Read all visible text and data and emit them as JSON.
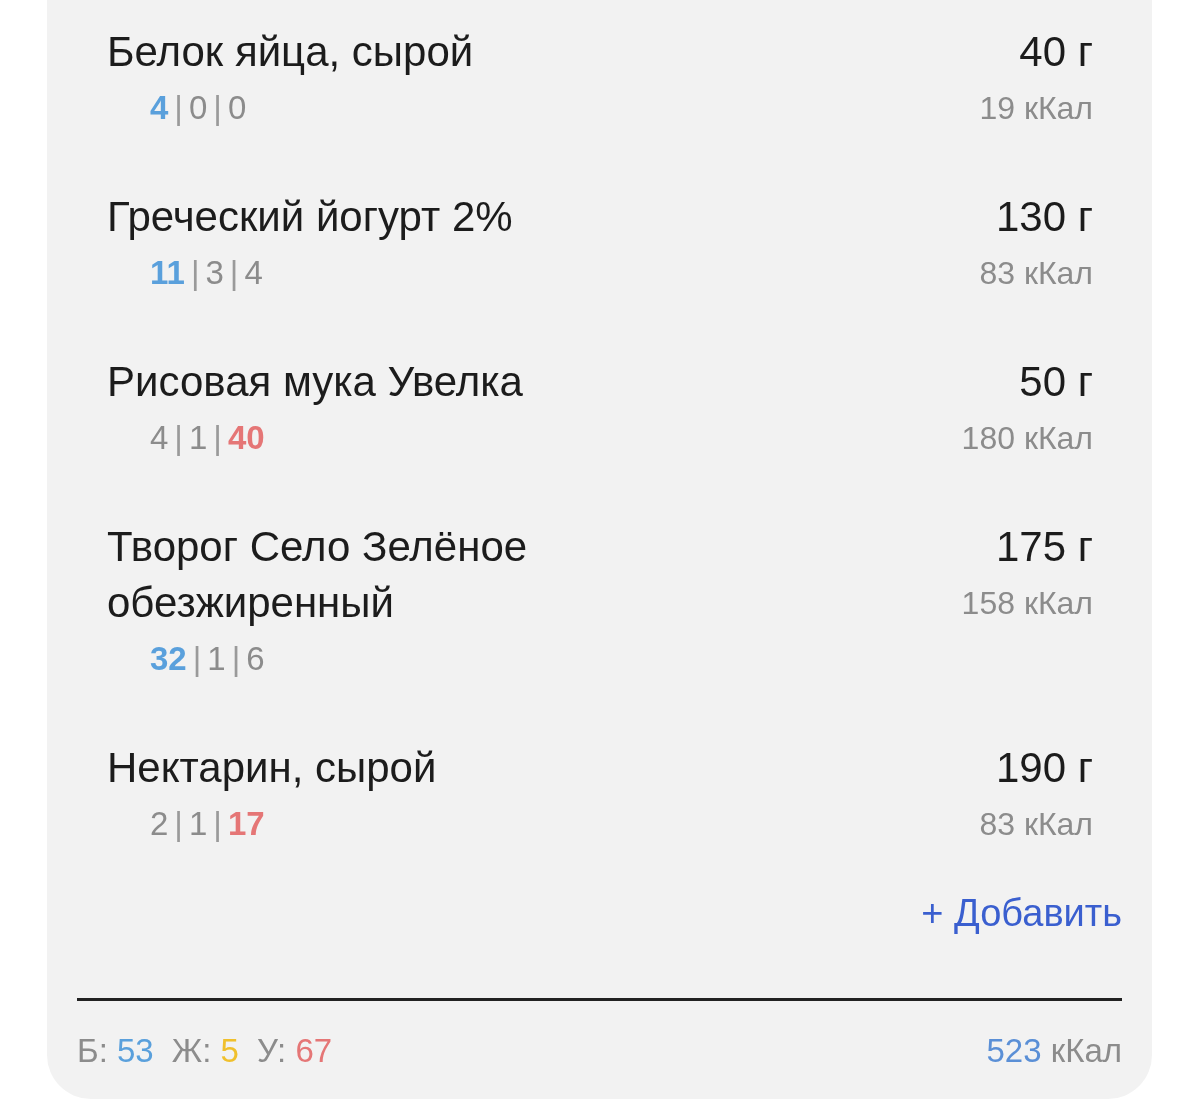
{
  "separator": "|",
  "items": [
    {
      "name": "Белок яйца, сырой",
      "weight": "40 г",
      "kcal": "19 кКал",
      "macros": [
        {
          "value": "4",
          "highlighted": true
        },
        {
          "value": "0",
          "highlighted": false
        },
        {
          "value": "0",
          "highlighted": false
        }
      ]
    },
    {
      "name": "Греческий йогурт 2%",
      "weight": "130 г",
      "kcal": "83 кКал",
      "macros": [
        {
          "value": "11",
          "highlighted": true
        },
        {
          "value": "3",
          "highlighted": false
        },
        {
          "value": "4",
          "highlighted": false
        }
      ]
    },
    {
      "name": "Рисовая мука Увелка",
      "weight": "50 г",
      "kcal": "180 кКал",
      "macros": [
        {
          "value": "4",
          "highlighted": false
        },
        {
          "value": "1",
          "highlighted": false
        },
        {
          "value": "40",
          "highlighted": true
        }
      ]
    },
    {
      "name": "Творог Село Зелёное обезжиренный",
      "weight": "175 г",
      "kcal": "158 кКал",
      "macros": [
        {
          "value": "32",
          "highlighted": true
        },
        {
          "value": "1",
          "highlighted": false
        },
        {
          "value": "6",
          "highlighted": false
        }
      ]
    },
    {
      "name": "Нектарин, сырой",
      "weight": "190 г",
      "kcal": "83 кКал",
      "macros": [
        {
          "value": "2",
          "highlighted": false
        },
        {
          "value": "1",
          "highlighted": false
        },
        {
          "value": "17",
          "highlighted": true
        }
      ]
    }
  ],
  "add_button": "+ Добавить",
  "totals": {
    "macros": [
      {
        "kind": "protein",
        "label": "Б:",
        "value": "53"
      },
      {
        "kind": "fat",
        "label": "Ж:",
        "value": "5"
      },
      {
        "kind": "carbs",
        "label": "У:",
        "value": "67"
      }
    ],
    "kcal_value": "523",
    "kcal_unit": "кКал"
  }
}
